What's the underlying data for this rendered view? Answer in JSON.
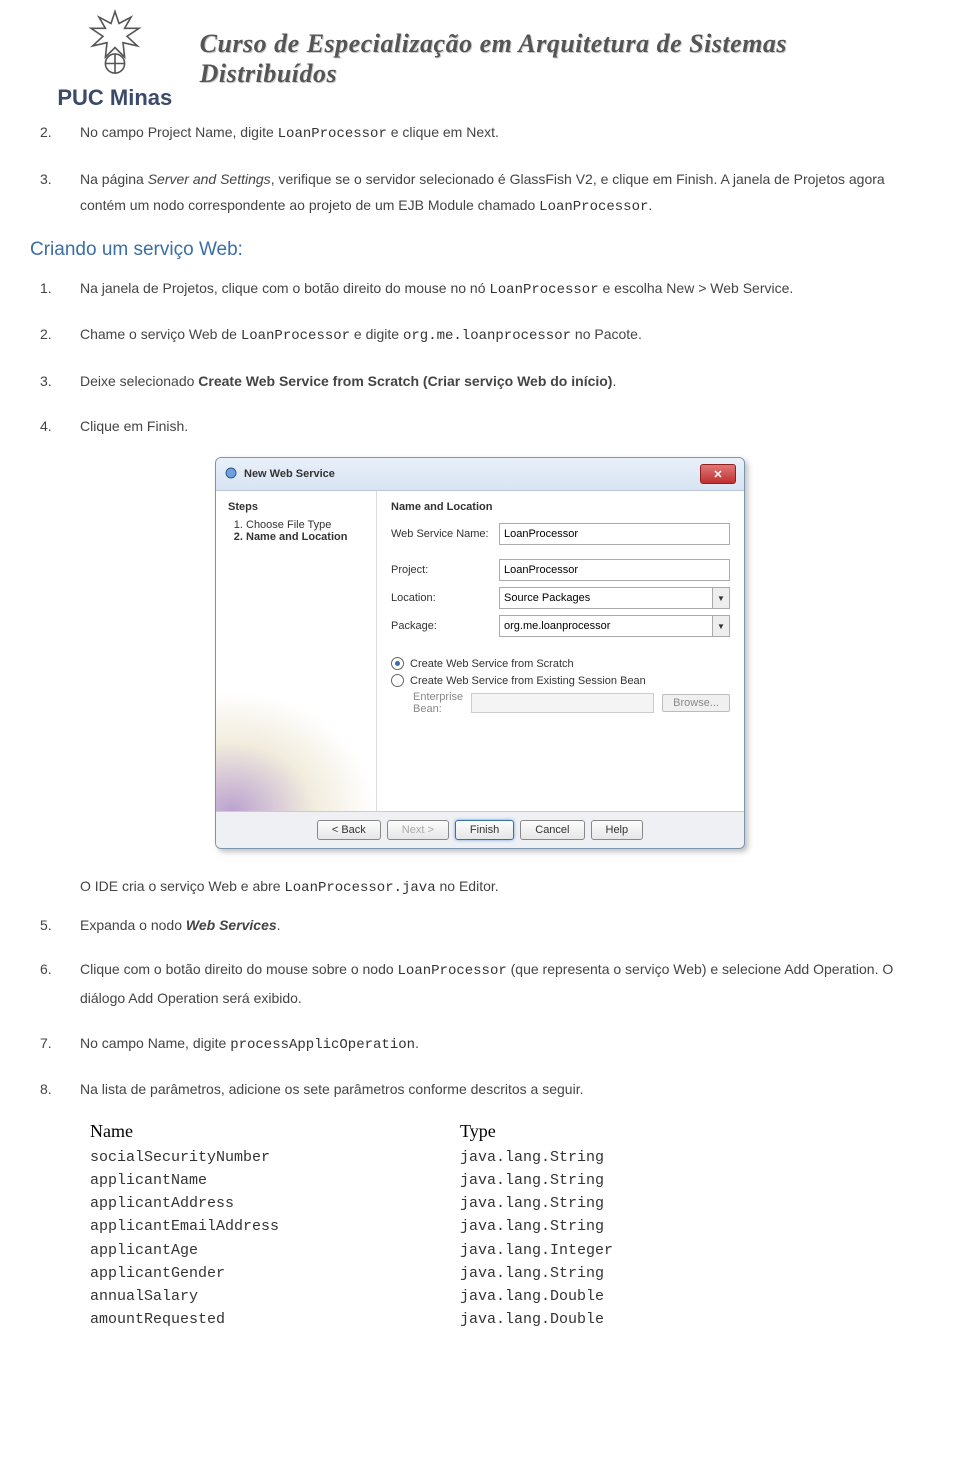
{
  "header": {
    "brand": "PUC Minas",
    "course": "Curso de Especialização em Arquitetura de Sistemas Distribuídos"
  },
  "top_list": [
    {
      "n": "2.",
      "parts": [
        {
          "t": "No campo Project Name, digite "
        },
        {
          "t": "LoanProcessor",
          "cls": "mono"
        },
        {
          "t": " e clique em Next."
        }
      ]
    },
    {
      "n": "3.",
      "parts": [
        {
          "t": "Na página "
        },
        {
          "t": "Server and Settings",
          "cls": "ital"
        },
        {
          "t": ", verifique se o servidor selecionado é GlassFish V2, e clique em Finish. A janela de Projetos agora contém um nodo correspondente ao projeto de um EJB Module chamado "
        },
        {
          "t": "LoanProcessor",
          "cls": "mono"
        },
        {
          "t": "."
        }
      ]
    }
  ],
  "section_title": "Criando um serviço Web:",
  "svc_list": [
    {
      "n": "1.",
      "parts": [
        {
          "t": "Na janela de Projetos, clique com o botão direito do mouse no nó "
        },
        {
          "t": "LoanProcessor",
          "cls": "mono"
        },
        {
          "t": " e escolha New > Web Service."
        }
      ]
    },
    {
      "n": "2.",
      "parts": [
        {
          "t": "Chame o serviço Web de "
        },
        {
          "t": "LoanProcessor",
          "cls": "mono"
        },
        {
          "t": " e digite "
        },
        {
          "t": "org.me.loanprocessor",
          "cls": "mono"
        },
        {
          "t": " no Pacote."
        }
      ]
    },
    {
      "n": "3.",
      "parts": [
        {
          "t": "Deixe selecionado "
        },
        {
          "t": "Create Web Service from Scratch (Criar serviço Web do início)",
          "cls": "bold"
        },
        {
          "t": "."
        }
      ]
    },
    {
      "n": "4.",
      "parts": [
        {
          "t": "Clique em Finish."
        }
      ]
    }
  ],
  "dialog": {
    "title": "New Web Service",
    "steps_head": "Steps",
    "steps": [
      "Choose File Type",
      "Name and Location"
    ],
    "panel_head": "Name and Location",
    "fields": {
      "name_lbl": "Web Service Name:",
      "name_val": "LoanProcessor",
      "project_lbl": "Project:",
      "project_val": "LoanProcessor",
      "location_lbl": "Location:",
      "location_val": "Source Packages",
      "package_lbl": "Package:",
      "package_val": "org.me.loanprocessor"
    },
    "radio1": "Create Web Service from Scratch",
    "radio2": "Create Web Service from Existing Session Bean",
    "ent_lbl": "Enterprise Bean:",
    "browse": "Browse...",
    "buttons": {
      "back": "< Back",
      "next": "Next >",
      "finish": "Finish",
      "cancel": "Cancel",
      "help": "Help"
    }
  },
  "after_dialog": {
    "parts": [
      {
        "t": "O IDE cria o serviço Web e abre "
      },
      {
        "t": "LoanProcessor.java",
        "cls": "mono"
      },
      {
        "t": " no Editor."
      }
    ]
  },
  "post_list": [
    {
      "n": "5.",
      "parts": [
        {
          "t": "Expanda o nodo "
        },
        {
          "t": "Web Services",
          "cls": "bold ital"
        },
        {
          "t": "."
        }
      ]
    },
    {
      "n": "6.",
      "parts": [
        {
          "t": "Clique com o botão direito do mouse sobre o nodo "
        },
        {
          "t": "LoanProcessor",
          "cls": "mono"
        },
        {
          "t": " (que representa o serviço Web) e selecione Add Operation. O diálogo Add Operation será exibido."
        }
      ]
    },
    {
      "n": "7.",
      "parts": [
        {
          "t": "No campo Name, digite "
        },
        {
          "t": "processApplicOperation",
          "cls": "mono"
        },
        {
          "t": "."
        }
      ]
    },
    {
      "n": "8.",
      "parts": [
        {
          "t": "Na lista de parâmetros, adicione os sete parâmetros conforme descritos a seguir."
        }
      ]
    }
  ],
  "param_table": {
    "head": {
      "name": "Name",
      "type": "Type"
    },
    "rows": [
      {
        "name": "socialSecurityNumber",
        "type": "java.lang.String"
      },
      {
        "name": "applicantName",
        "type": "java.lang.String"
      },
      {
        "name": "applicantAddress",
        "type": "java.lang.String"
      },
      {
        "name": "applicantEmailAddress",
        "type": "java.lang.String"
      },
      {
        "name": "applicantAge",
        "type": "java.lang.Integer"
      },
      {
        "name": "applicantGender",
        "type": "java.lang.String"
      },
      {
        "name": "annualSalary",
        "type": "java.lang.Double"
      },
      {
        "name": "amountRequested",
        "type": "java.lang.Double"
      }
    ]
  }
}
